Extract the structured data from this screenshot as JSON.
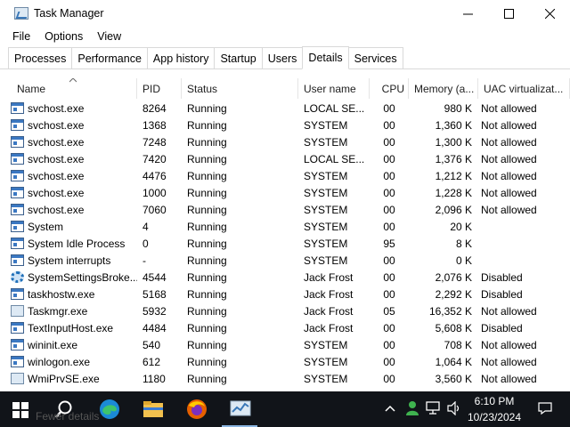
{
  "window": {
    "title": "Task Manager"
  },
  "menu": [
    "File",
    "Options",
    "View"
  ],
  "tabs": [
    {
      "label": "Processes"
    },
    {
      "label": "Performance"
    },
    {
      "label": "App history"
    },
    {
      "label": "Startup"
    },
    {
      "label": "Users"
    },
    {
      "label": "Details",
      "active": true
    },
    {
      "label": "Services"
    }
  ],
  "columns": {
    "name": "Name",
    "pid": "PID",
    "status": "Status",
    "user": "User name",
    "cpu": "CPU",
    "memory": "Memory (a...",
    "uac": "UAC virtualizat..."
  },
  "rows": [
    {
      "icon": "svc",
      "name": "svchost.exe",
      "pid": "8264",
      "status": "Running",
      "user": "LOCAL SE...",
      "cpu": "00",
      "memory": "980 K",
      "uac": "Not allowed"
    },
    {
      "icon": "svc",
      "name": "svchost.exe",
      "pid": "1368",
      "status": "Running",
      "user": "SYSTEM",
      "cpu": "00",
      "memory": "1,360 K",
      "uac": "Not allowed"
    },
    {
      "icon": "svc",
      "name": "svchost.exe",
      "pid": "7248",
      "status": "Running",
      "user": "SYSTEM",
      "cpu": "00",
      "memory": "1,300 K",
      "uac": "Not allowed"
    },
    {
      "icon": "svc",
      "name": "svchost.exe",
      "pid": "7420",
      "status": "Running",
      "user": "LOCAL SE...",
      "cpu": "00",
      "memory": "1,376 K",
      "uac": "Not allowed"
    },
    {
      "icon": "svc",
      "name": "svchost.exe",
      "pid": "4476",
      "status": "Running",
      "user": "SYSTEM",
      "cpu": "00",
      "memory": "1,212 K",
      "uac": "Not allowed"
    },
    {
      "icon": "svc",
      "name": "svchost.exe",
      "pid": "1000",
      "status": "Running",
      "user": "SYSTEM",
      "cpu": "00",
      "memory": "1,228 K",
      "uac": "Not allowed"
    },
    {
      "icon": "svc",
      "name": "svchost.exe",
      "pid": "7060",
      "status": "Running",
      "user": "SYSTEM",
      "cpu": "00",
      "memory": "2,096 K",
      "uac": "Not allowed"
    },
    {
      "icon": "svc",
      "name": "System",
      "pid": "4",
      "status": "Running",
      "user": "SYSTEM",
      "cpu": "00",
      "memory": "20 K",
      "uac": ""
    },
    {
      "icon": "svc",
      "name": "System Idle Process",
      "pid": "0",
      "status": "Running",
      "user": "SYSTEM",
      "cpu": "95",
      "memory": "8 K",
      "uac": ""
    },
    {
      "icon": "svc",
      "name": "System interrupts",
      "pid": "-",
      "status": "Running",
      "user": "SYSTEM",
      "cpu": "00",
      "memory": "0 K",
      "uac": ""
    },
    {
      "icon": "gear",
      "name": "SystemSettingsBroke...",
      "pid": "4544",
      "status": "Running",
      "user": "Jack Frost",
      "cpu": "00",
      "memory": "2,076 K",
      "uac": "Disabled"
    },
    {
      "icon": "svc",
      "name": "taskhostw.exe",
      "pid": "5168",
      "status": "Running",
      "user": "Jack Frost",
      "cpu": "00",
      "memory": "2,292 K",
      "uac": "Disabled"
    },
    {
      "icon": "tm",
      "name": "Taskmgr.exe",
      "pid": "5932",
      "status": "Running",
      "user": "Jack Frost",
      "cpu": "05",
      "memory": "16,352 K",
      "uac": "Not allowed"
    },
    {
      "icon": "svc",
      "name": "TextInputHost.exe",
      "pid": "4484",
      "status": "Running",
      "user": "Jack Frost",
      "cpu": "00",
      "memory": "5,608 K",
      "uac": "Disabled"
    },
    {
      "icon": "svc",
      "name": "wininit.exe",
      "pid": "540",
      "status": "Running",
      "user": "SYSTEM",
      "cpu": "00",
      "memory": "708 K",
      "uac": "Not allowed"
    },
    {
      "icon": "svc",
      "name": "winlogon.exe",
      "pid": "612",
      "status": "Running",
      "user": "SYSTEM",
      "cpu": "00",
      "memory": "1,064 K",
      "uac": "Not allowed"
    },
    {
      "icon": "tm",
      "name": "WmiPrvSE.exe",
      "pid": "1180",
      "status": "Running",
      "user": "SYSTEM",
      "cpu": "00",
      "memory": "3,560 K",
      "uac": "Not allowed"
    }
  ],
  "footer": {
    "fewer_details": "Fewer details"
  },
  "taskbar": {
    "time": "6:10 PM",
    "date": "10/23/2024",
    "icons": [
      "windows-start-icon",
      "search-icon",
      "edge-icon",
      "file-explorer-icon",
      "firefox-icon",
      "task-manager-icon"
    ],
    "tray_icons": [
      "chevron-up-icon",
      "user-tray-icon",
      "network-icon",
      "volume-icon",
      "notification-icon"
    ]
  },
  "colors": {
    "taskbar_bg": "#111419",
    "text": "#000000",
    "tab_border": "#d9d9d9"
  }
}
